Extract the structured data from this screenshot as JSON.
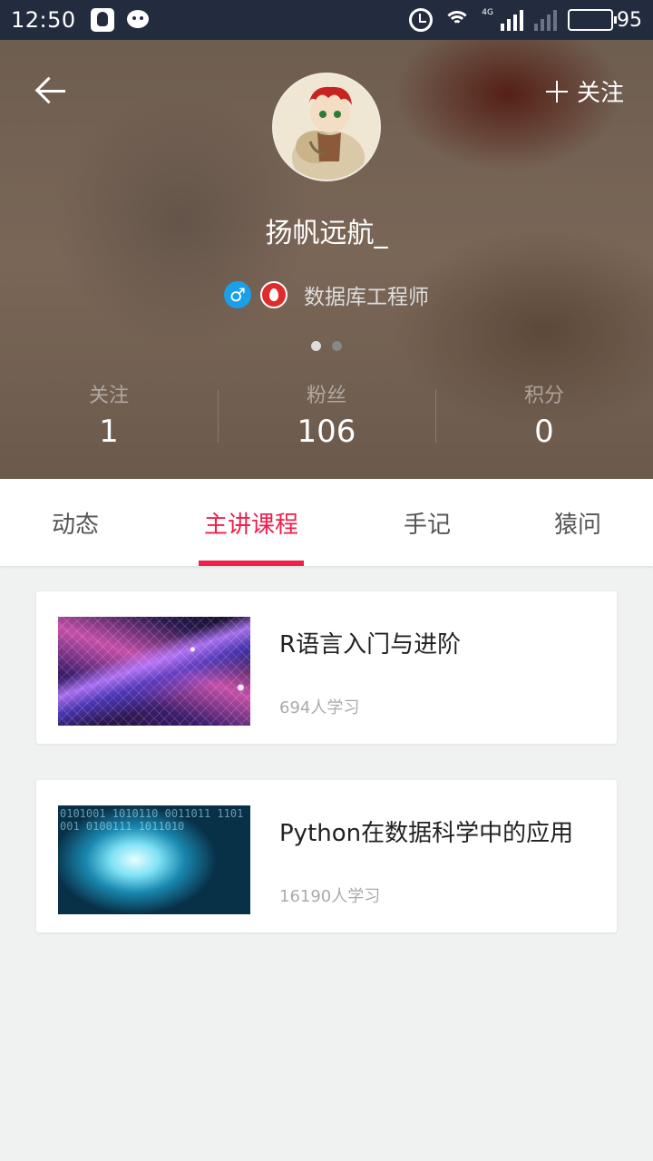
{
  "status_bar": {
    "time": "12:50",
    "network": "4G",
    "battery": "95",
    "battery_level": 0.95
  },
  "header": {
    "back_icon": "arrow-left-icon",
    "follow_label": "关注",
    "username": "扬帆远航_",
    "gender": "male",
    "job_title": "数据库工程师",
    "pager": {
      "count": 2,
      "active": 0
    },
    "stats": [
      {
        "label": "关注",
        "value": "1"
      },
      {
        "label": "粉丝",
        "value": "106"
      },
      {
        "label": "积分",
        "value": "0"
      }
    ]
  },
  "tabs": [
    {
      "label": "动态",
      "active": false
    },
    {
      "label": "主讲课程",
      "active": true
    },
    {
      "label": "手记",
      "active": false
    },
    {
      "label": "猿问",
      "active": false
    }
  ],
  "courses": [
    {
      "title": "R语言入门与进阶",
      "learners": "694人学习"
    },
    {
      "title": "Python在数据科学中的应用",
      "learners": "16190人学习"
    }
  ],
  "colors": {
    "accent": "#f01e4a",
    "status_bar": "#232c3f",
    "gender_badge": "#1aa0e8",
    "fire_badge": "#e02b2b"
  }
}
